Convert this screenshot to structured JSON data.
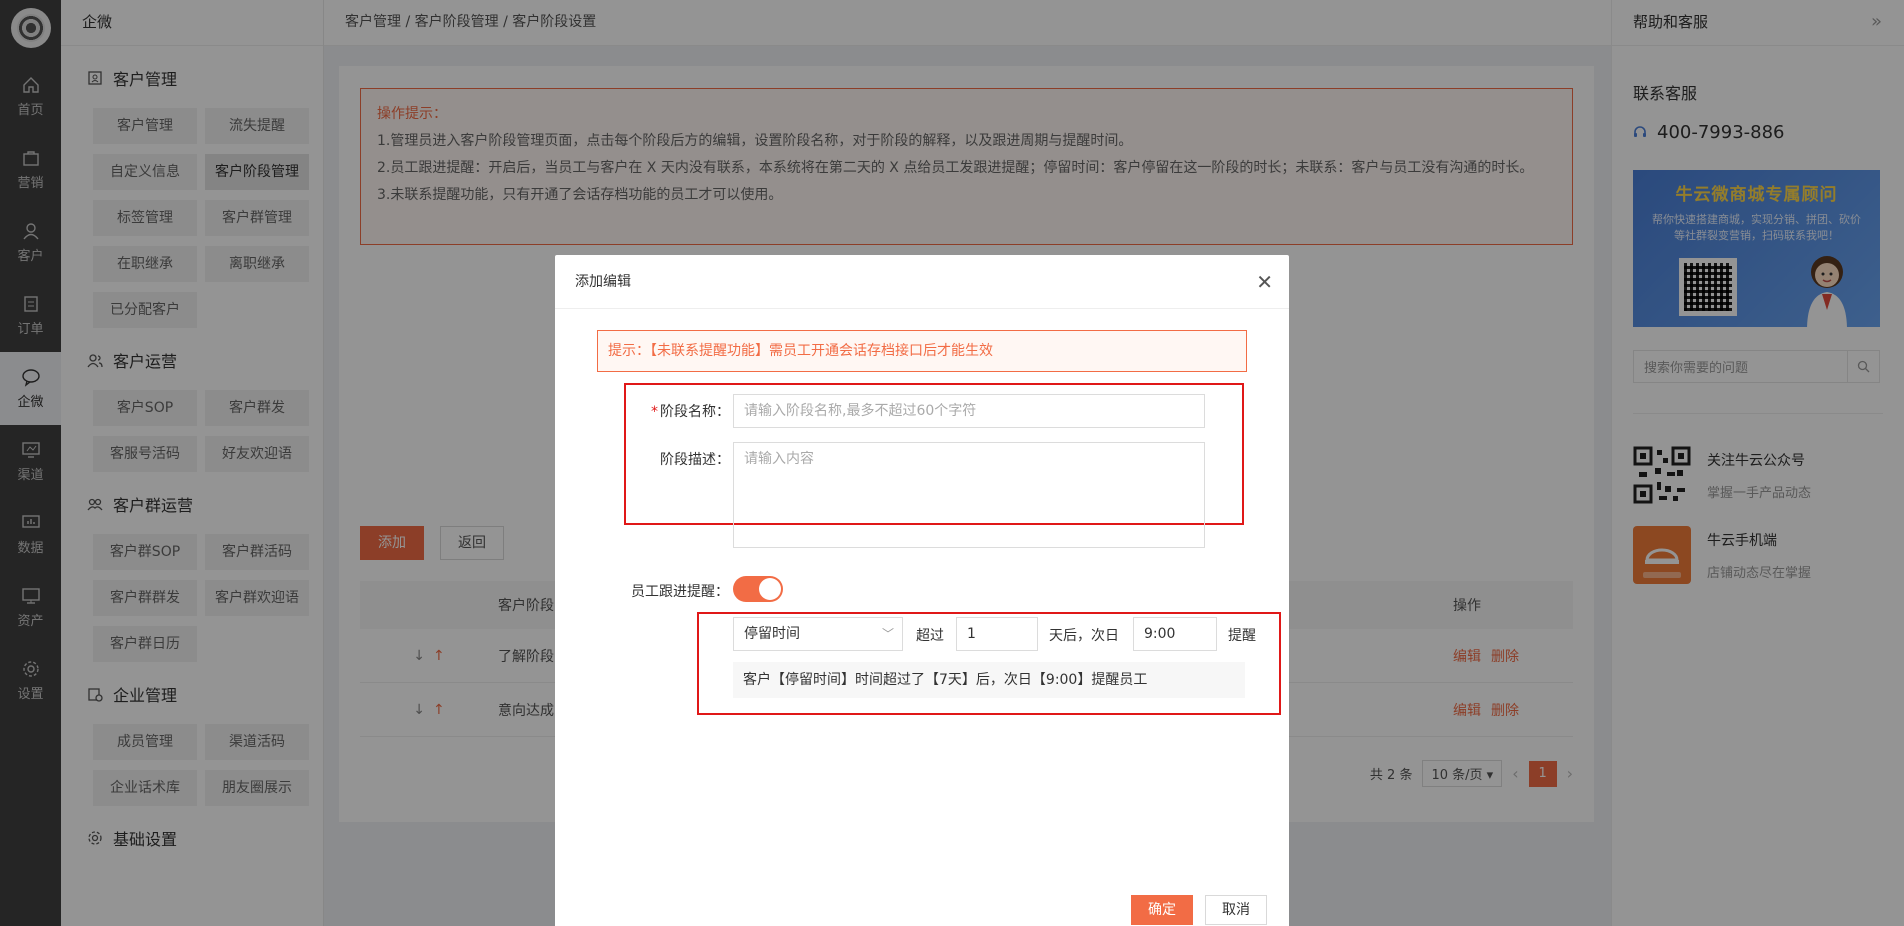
{
  "rail": {
    "items": [
      {
        "label": "首页",
        "icon": "home-icon"
      },
      {
        "label": "营销",
        "icon": "bag-icon"
      },
      {
        "label": "客户",
        "icon": "user-icon"
      },
      {
        "label": "订单",
        "icon": "list-icon"
      },
      {
        "label": "企微",
        "icon": "chat-icon",
        "active": true
      },
      {
        "label": "渠道",
        "icon": "monitor-icon"
      },
      {
        "label": "数据",
        "icon": "chart-icon"
      },
      {
        "label": "资产",
        "icon": "screen-icon"
      },
      {
        "label": "设置",
        "icon": "gear-icon"
      }
    ]
  },
  "subnav": {
    "brand": "企微",
    "groups": [
      {
        "title": "客户管理",
        "chips": [
          "客户管理",
          "流失提醒",
          "自定义信息",
          "客户阶段管理",
          "标签管理",
          "客户群管理",
          "在职继承",
          "离职继承",
          "已分配客户"
        ]
      },
      {
        "title": "客户运营",
        "chips": [
          "客户SOP",
          "客户群发",
          "客服号活码",
          "好友欢迎语"
        ]
      },
      {
        "title": "客户群运营",
        "chips": [
          "客户群SOP",
          "客户群活码",
          "客户群群发",
          "客户群欢迎语",
          "客户群日历"
        ]
      },
      {
        "title": "企业管理",
        "chips": [
          "成员管理",
          "渠道活码",
          "企业话术库",
          "朋友圈展示"
        ]
      },
      {
        "title": "基础设置",
        "chips": []
      }
    ]
  },
  "breadcrumb": "客户管理 / 客户阶段管理 / 客户阶段设置",
  "tips": {
    "title": "操作提示：",
    "lines": [
      "1.管理员进入客户阶段管理页面，点击每个阶段后方的编辑，设置阶段名称，对于阶段的解释，以及跟进周期与提醒时间。",
      "2.员工跟进提醒：开启后，当员工与客户在 X 天内没有联系，本系统将在第二天的 X 点给员工发跟进提醒；停留时间：客户停留在这一阶段的时长；未联系：客户与员工没有沟通的时长。",
      "3.未联系提醒功能，只有开通了会话存档功能的员工才可以使用。"
    ]
  },
  "actions": {
    "add": "添加",
    "back": "返回"
  },
  "table": {
    "head_name": "客户阶段",
    "head_op": "操作",
    "rows": [
      {
        "name": "了解阶段",
        "edit": "编辑",
        "del": "删除"
      },
      {
        "name": "意向达成",
        "edit": "编辑",
        "del": "删除"
      }
    ],
    "arrow_down": "↓",
    "arrow_up": "↑"
  },
  "pager": {
    "total": "共 2 条",
    "size": "10 条/页",
    "page": "1"
  },
  "help": {
    "title": "帮助和客服",
    "contact": "联系客服",
    "phone": "400-7993-886",
    "banner_title_a": "牛云微商城",
    "banner_title_b": "专属顾问",
    "banner_sub": "帮你快速搭建商城，实现分销、拼团、砍价等社群裂变营销，扫码联系我吧！",
    "search_placeholder": "搜索你需要的问题",
    "promos": [
      {
        "title": "关注牛云公众号",
        "sub": "掌握一手产品动态"
      },
      {
        "title": "牛云手机端",
        "sub": "店铺动态尽在掌握"
      }
    ]
  },
  "modal": {
    "title": "添加编辑",
    "alert": "提示：【未联系提醒功能】需员工开通会话存档接口后才能生效",
    "name_label": "阶段名称：",
    "name_placeholder": "请输入阶段名称,最多不超过60个字符",
    "desc_label": "阶段描述：",
    "desc_placeholder": "请输入内容",
    "remind_label": "员工跟进提醒：",
    "remind_on": true,
    "mode": "停留时间",
    "over": "超过",
    "days": "1",
    "after": "天后，次日",
    "time": "9:00",
    "remind": "提醒",
    "summary": "客户【停留时间】时间超过了【7天】后，次日【9:00】提醒员工",
    "ok": "确定",
    "cancel": "取消"
  }
}
